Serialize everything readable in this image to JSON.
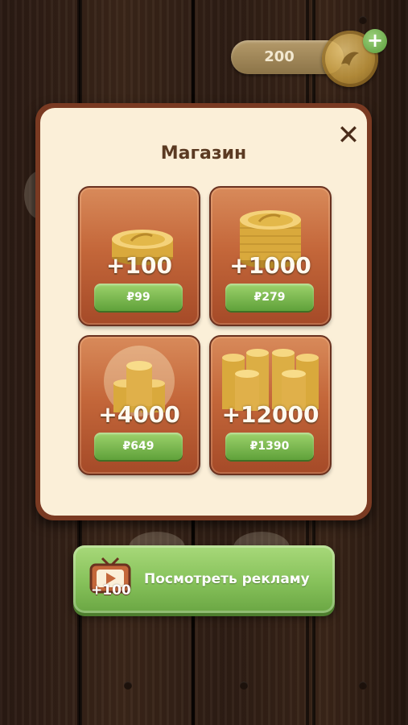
{
  "currency": {
    "value": "200",
    "plus": "+"
  },
  "shop": {
    "title": "Магазин",
    "close": "✕",
    "packs": [
      {
        "amount": "+100",
        "price": "₽99"
      },
      {
        "amount": "+1000",
        "price": "₽279"
      },
      {
        "amount": "+4000",
        "price": "₽649"
      },
      {
        "amount": "+12000",
        "price": "₽1390"
      }
    ]
  },
  "ad": {
    "label": "Посмотреть рекламу",
    "bonus": "+100"
  },
  "colors": {
    "modal_border": "#7a3a22",
    "modal_bg": "#fbefd8",
    "card": "#c4673a",
    "green": "#86c15a",
    "coin_gold": "#e3b84a"
  },
  "icons": {
    "close": "close-icon",
    "coin": "coin-stack-icon",
    "tv": "tv-play-icon",
    "plus": "plus-icon"
  }
}
